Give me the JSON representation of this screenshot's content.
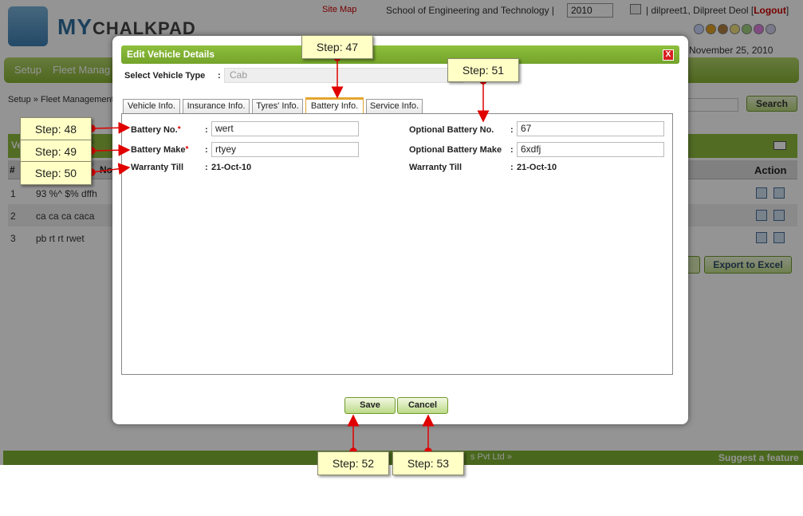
{
  "app": {
    "logo_text": "MY",
    "logo_text_sub": "CHALKPAD",
    "site_map": "Site Map",
    "school": "School of Engineering and Technology |",
    "year": "2010",
    "user": "| dilpreet1, Dilpreet Deol [",
    "logout": "Logout",
    "logout_close": "]",
    "date": "November 25, 2010"
  },
  "nav": {
    "items": [
      "Setup",
      "Fleet Manag"
    ]
  },
  "breadcrumb": "Setup » Fleet Management",
  "search": {
    "button": "Search"
  },
  "grid": {
    "header_col_hash": "#",
    "header_col_no": "No",
    "header_col_action": "Action",
    "rows": [
      {
        "num": "1",
        "value": "93 %^ $% dffh"
      },
      {
        "num": "2",
        "value": "ca ca ca caca"
      },
      {
        "num": "3",
        "value": "pb rt rt rwet"
      }
    ],
    "export": "Export to Excel",
    "head_label": "Ve"
  },
  "footer": {
    "suggest": "Suggest a feature",
    "partial": "s Pvt Ltd »"
  },
  "modal": {
    "title": "Edit Vehicle Details",
    "close": "X",
    "vehicle_type_label": "Select Vehicle Type",
    "colon": ":",
    "vehicle_type_value": "Cab",
    "tabs": [
      "Vehicle Info.",
      "Insurance Info.",
      "Tyres' Info.",
      "Battery Info.",
      "Service Info."
    ],
    "active_tab": "Battery Info.",
    "battery_no_label": "Battery No.",
    "battery_no": "wert",
    "battery_make_label": "Battery Make",
    "battery_make": "rtyey",
    "warranty_label": "Warranty Till",
    "warranty": "21-Oct-10",
    "opt_battery_no_label": "Optional Battery No.",
    "opt_battery_no": "67",
    "opt_battery_make_label": "Optional Battery Make",
    "opt_battery_make": "6xdfj",
    "opt_warranty_label": "Warranty Till",
    "opt_warranty": "21-Oct-10",
    "required_mark": "*",
    "save": "Save",
    "cancel": "Cancel"
  },
  "steps": {
    "s47": "Step: 47",
    "s48": "Step: 48",
    "s49": "Step: 49",
    "s50": "Step: 50",
    "s51": "Step: 51",
    "s52": "Step: 52",
    "s53": "Step: 53"
  },
  "colors": {
    "accent_green": "#86b234",
    "callout_bg": "#ffffc6",
    "arrow_red": "#e00000"
  }
}
